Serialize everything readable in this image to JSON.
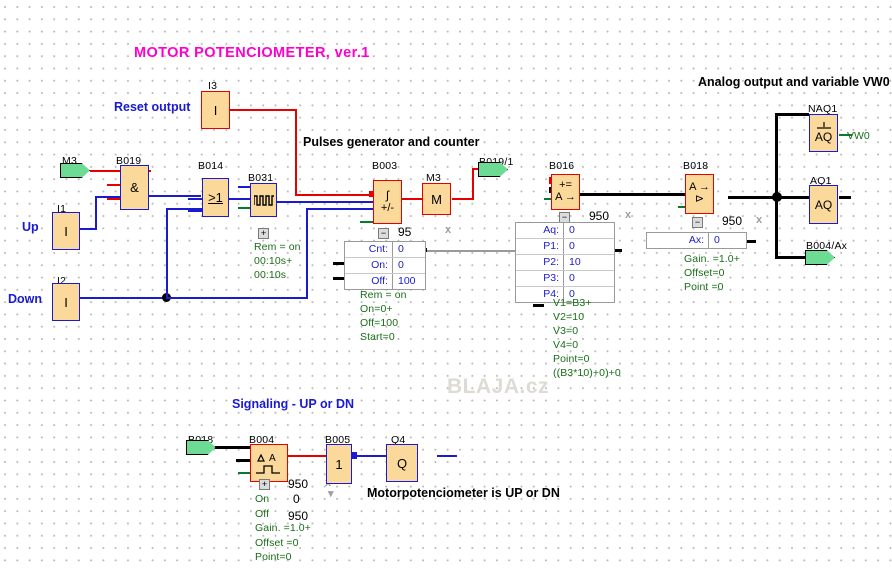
{
  "page": {
    "title": "MOTOR POTENCIOMETER, ver.1",
    "watermark": "BLAJA.cz"
  },
  "comments": [
    {
      "id": "title",
      "text": "MOTOR POTENCIOMETER, ver.1"
    },
    {
      "id": "reset",
      "text": "Reset output"
    },
    {
      "id": "pulses",
      "text": "Pulses generator and counter"
    },
    {
      "id": "analog",
      "text": "Analog output and variable VW0"
    },
    {
      "id": "signaling",
      "text": "Signaling - UP or DN"
    },
    {
      "id": "motorpot",
      "text": "Motorpotenciometer is UP or DN"
    },
    {
      "id": "up",
      "text": "Up"
    },
    {
      "id": "down",
      "text": "Down"
    }
  ],
  "blocks": {
    "i3": {
      "label": "I3",
      "symbol": "I"
    },
    "i1": {
      "label": "I1",
      "symbol": "I"
    },
    "i2": {
      "label": "I2",
      "symbol": "I"
    },
    "m3in": {
      "label": "M3"
    },
    "b019": {
      "label": "B019",
      "symbol": "&"
    },
    "b014": {
      "label": "B014",
      "symbol": ">1"
    },
    "b031": {
      "label": "B031",
      "symbol": "pulse"
    },
    "b003": {
      "label": "B003",
      "symbol_top": "ʃ",
      "symbol_bottom": "+/-"
    },
    "m3": {
      "label": "M3",
      "symbol": "M"
    },
    "b019_1": {
      "label": "B019/1"
    },
    "b016": {
      "label": "B016",
      "symbol_top": "+=",
      "symbol_bottom": "A →"
    },
    "b018": {
      "label": "B018",
      "symbol_top": "A →",
      "symbol_bottom": "⊳"
    },
    "naq1": {
      "label": "NAQ1",
      "symbol": "AQ",
      "out": "VW0"
    },
    "aq1": {
      "label": "AQ1",
      "symbol": "AQ"
    },
    "b004ax": {
      "label": "B004/Ax"
    },
    "b018p": {
      "label": "B018"
    },
    "b004": {
      "label": "B004",
      "symbol_top": "△ A",
      "symbol_bottom": "⌐⌐"
    },
    "b005": {
      "label": "B005",
      "symbol": "1"
    },
    "q4": {
      "label": "Q4",
      "symbol": "Q"
    }
  },
  "params": {
    "b031": {
      "notes": [
        "Rem = on",
        "00:10s+",
        "00:10s"
      ]
    },
    "b003": {
      "value": "95",
      "rows": [
        {
          "key": "Cnt:",
          "val": "0"
        },
        {
          "key": "On:",
          "val": "0"
        },
        {
          "key": "Off:",
          "val": "100"
        }
      ],
      "notes": [
        "Rem = on",
        "On=0+",
        "Off=100",
        "Start=0"
      ]
    },
    "b016": {
      "value": "950",
      "rows": [
        {
          "key": "Aq:",
          "val": "0"
        },
        {
          "key": "P1:",
          "val": "0"
        },
        {
          "key": "P2:",
          "val": "10"
        },
        {
          "key": "P3:",
          "val": "0"
        },
        {
          "key": "P4:",
          "val": "0"
        }
      ],
      "notes": [
        "V1=B3+",
        "V2=10",
        "V3=0",
        "V4=0",
        "Point=0",
        "((B3*10)+0)+0"
      ]
    },
    "b018": {
      "value": "950",
      "rows": [
        {
          "key": "Ax:",
          "val": "0"
        }
      ],
      "notes": [
        "Gain. =1.0+",
        "Offset=0",
        "Point =0"
      ]
    },
    "b004": {
      "value": "950",
      "on_label": "On",
      "on_value": "0",
      "off_label": "Off",
      "off_value": "950",
      "notes": [
        "Gain. =1.0+",
        "Offset =0",
        "Point=0"
      ]
    }
  },
  "colors": {
    "block_fill": "#fbd99b",
    "block_border_blue": "#1a1ad0",
    "block_border_red": "#e60000",
    "wire_blue": "#1a1ad0",
    "wire_red": "#e60000",
    "wire_black": "#000000",
    "note_green": "#186e18",
    "port_green": "#6ddb94",
    "title_magenta": "#ff00cc",
    "grid_dot": "#b9b9b9"
  }
}
